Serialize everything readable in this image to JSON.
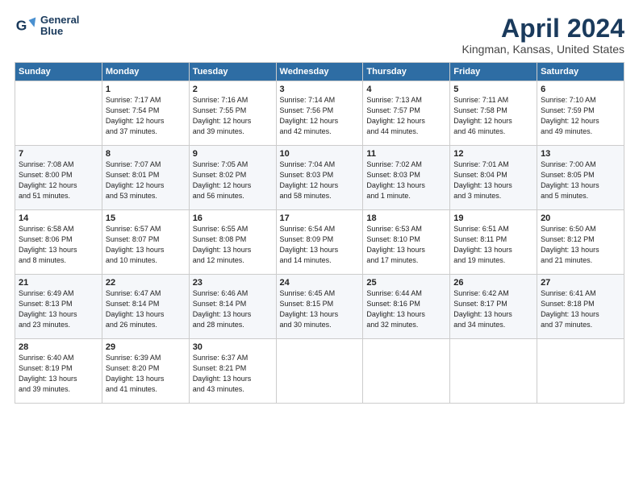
{
  "logo": {
    "line1": "General",
    "line2": "Blue"
  },
  "title": "April 2024",
  "subtitle": "Kingman, Kansas, United States",
  "headers": [
    "Sunday",
    "Monday",
    "Tuesday",
    "Wednesday",
    "Thursday",
    "Friday",
    "Saturday"
  ],
  "weeks": [
    [
      {
        "day": "",
        "text": ""
      },
      {
        "day": "1",
        "text": "Sunrise: 7:17 AM\nSunset: 7:54 PM\nDaylight: 12 hours\nand 37 minutes."
      },
      {
        "day": "2",
        "text": "Sunrise: 7:16 AM\nSunset: 7:55 PM\nDaylight: 12 hours\nand 39 minutes."
      },
      {
        "day": "3",
        "text": "Sunrise: 7:14 AM\nSunset: 7:56 PM\nDaylight: 12 hours\nand 42 minutes."
      },
      {
        "day": "4",
        "text": "Sunrise: 7:13 AM\nSunset: 7:57 PM\nDaylight: 12 hours\nand 44 minutes."
      },
      {
        "day": "5",
        "text": "Sunrise: 7:11 AM\nSunset: 7:58 PM\nDaylight: 12 hours\nand 46 minutes."
      },
      {
        "day": "6",
        "text": "Sunrise: 7:10 AM\nSunset: 7:59 PM\nDaylight: 12 hours\nand 49 minutes."
      }
    ],
    [
      {
        "day": "7",
        "text": "Sunrise: 7:08 AM\nSunset: 8:00 PM\nDaylight: 12 hours\nand 51 minutes."
      },
      {
        "day": "8",
        "text": "Sunrise: 7:07 AM\nSunset: 8:01 PM\nDaylight: 12 hours\nand 53 minutes."
      },
      {
        "day": "9",
        "text": "Sunrise: 7:05 AM\nSunset: 8:02 PM\nDaylight: 12 hours\nand 56 minutes."
      },
      {
        "day": "10",
        "text": "Sunrise: 7:04 AM\nSunset: 8:03 PM\nDaylight: 12 hours\nand 58 minutes."
      },
      {
        "day": "11",
        "text": "Sunrise: 7:02 AM\nSunset: 8:03 PM\nDaylight: 13 hours\nand 1 minute."
      },
      {
        "day": "12",
        "text": "Sunrise: 7:01 AM\nSunset: 8:04 PM\nDaylight: 13 hours\nand 3 minutes."
      },
      {
        "day": "13",
        "text": "Sunrise: 7:00 AM\nSunset: 8:05 PM\nDaylight: 13 hours\nand 5 minutes."
      }
    ],
    [
      {
        "day": "14",
        "text": "Sunrise: 6:58 AM\nSunset: 8:06 PM\nDaylight: 13 hours\nand 8 minutes."
      },
      {
        "day": "15",
        "text": "Sunrise: 6:57 AM\nSunset: 8:07 PM\nDaylight: 13 hours\nand 10 minutes."
      },
      {
        "day": "16",
        "text": "Sunrise: 6:55 AM\nSunset: 8:08 PM\nDaylight: 13 hours\nand 12 minutes."
      },
      {
        "day": "17",
        "text": "Sunrise: 6:54 AM\nSunset: 8:09 PM\nDaylight: 13 hours\nand 14 minutes."
      },
      {
        "day": "18",
        "text": "Sunrise: 6:53 AM\nSunset: 8:10 PM\nDaylight: 13 hours\nand 17 minutes."
      },
      {
        "day": "19",
        "text": "Sunrise: 6:51 AM\nSunset: 8:11 PM\nDaylight: 13 hours\nand 19 minutes."
      },
      {
        "day": "20",
        "text": "Sunrise: 6:50 AM\nSunset: 8:12 PM\nDaylight: 13 hours\nand 21 minutes."
      }
    ],
    [
      {
        "day": "21",
        "text": "Sunrise: 6:49 AM\nSunset: 8:13 PM\nDaylight: 13 hours\nand 23 minutes."
      },
      {
        "day": "22",
        "text": "Sunrise: 6:47 AM\nSunset: 8:14 PM\nDaylight: 13 hours\nand 26 minutes."
      },
      {
        "day": "23",
        "text": "Sunrise: 6:46 AM\nSunset: 8:14 PM\nDaylight: 13 hours\nand 28 minutes."
      },
      {
        "day": "24",
        "text": "Sunrise: 6:45 AM\nSunset: 8:15 PM\nDaylight: 13 hours\nand 30 minutes."
      },
      {
        "day": "25",
        "text": "Sunrise: 6:44 AM\nSunset: 8:16 PM\nDaylight: 13 hours\nand 32 minutes."
      },
      {
        "day": "26",
        "text": "Sunrise: 6:42 AM\nSunset: 8:17 PM\nDaylight: 13 hours\nand 34 minutes."
      },
      {
        "day": "27",
        "text": "Sunrise: 6:41 AM\nSunset: 8:18 PM\nDaylight: 13 hours\nand 37 minutes."
      }
    ],
    [
      {
        "day": "28",
        "text": "Sunrise: 6:40 AM\nSunset: 8:19 PM\nDaylight: 13 hours\nand 39 minutes."
      },
      {
        "day": "29",
        "text": "Sunrise: 6:39 AM\nSunset: 8:20 PM\nDaylight: 13 hours\nand 41 minutes."
      },
      {
        "day": "30",
        "text": "Sunrise: 6:37 AM\nSunset: 8:21 PM\nDaylight: 13 hours\nand 43 minutes."
      },
      {
        "day": "",
        "text": ""
      },
      {
        "day": "",
        "text": ""
      },
      {
        "day": "",
        "text": ""
      },
      {
        "day": "",
        "text": ""
      }
    ]
  ]
}
